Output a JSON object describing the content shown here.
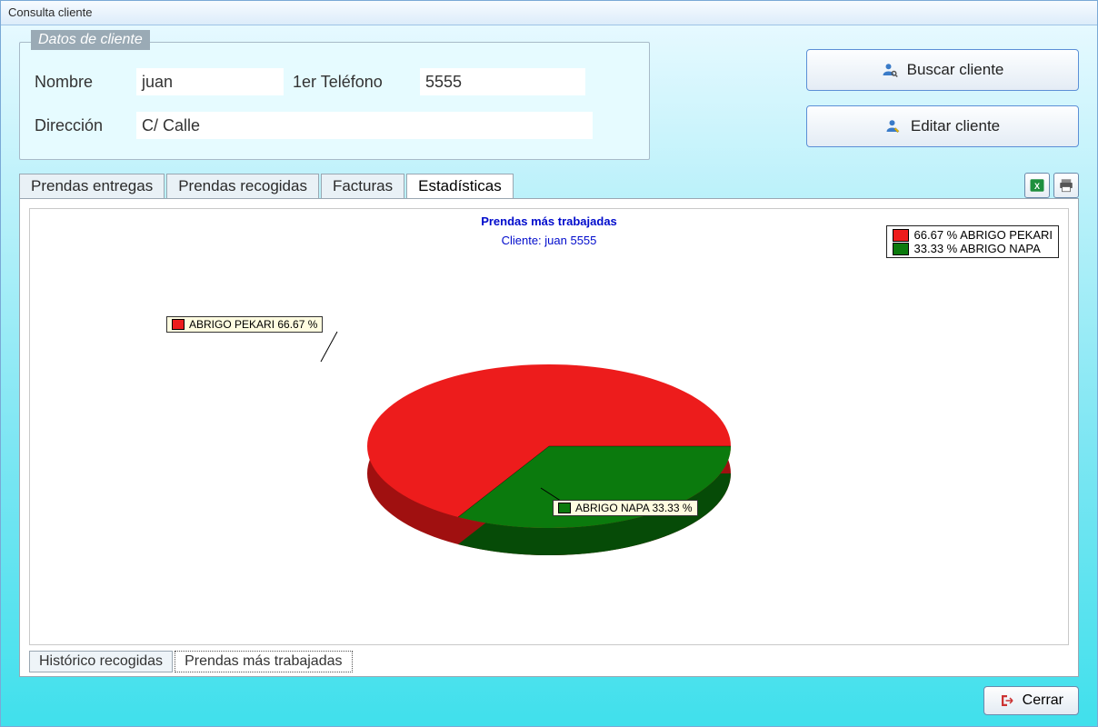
{
  "window": {
    "title": "Consulta cliente"
  },
  "client_box": {
    "legend": "Datos de cliente",
    "name_label": "Nombre",
    "name_value": "juan",
    "phone_label": "1er Teléfono",
    "phone_value": "5555",
    "address_label": "Dirección",
    "address_value": "C/ Calle"
  },
  "actions": {
    "search": "Buscar cliente",
    "edit": "Editar cliente",
    "close": "Cerrar"
  },
  "tabs": {
    "t0": "Prendas entregas",
    "t1": "Prendas recogidas",
    "t2": "Facturas",
    "t3": "Estadísticas"
  },
  "bottom_tabs": {
    "b0": "Histórico recogidas",
    "b1": "Prendas más trabajadas"
  },
  "chart_data": {
    "type": "pie",
    "title": "Prendas más trabajadas",
    "subtitle": "Cliente: juan 5555",
    "series": [
      {
        "name": "ABRIGO PEKARI",
        "value": 66.67,
        "color": "#ed1c1c"
      },
      {
        "name": "ABRIGO NAPA",
        "value": 33.33,
        "color": "#0b7a0d"
      }
    ],
    "legend_text_0": "66.67 % ABRIGO PEKARI",
    "legend_text_1": "33.33 % ABRIGO NAPA",
    "callout_0": "ABRIGO PEKARI 66.67 %",
    "callout_1": "ABRIGO NAPA 33.33 %"
  }
}
